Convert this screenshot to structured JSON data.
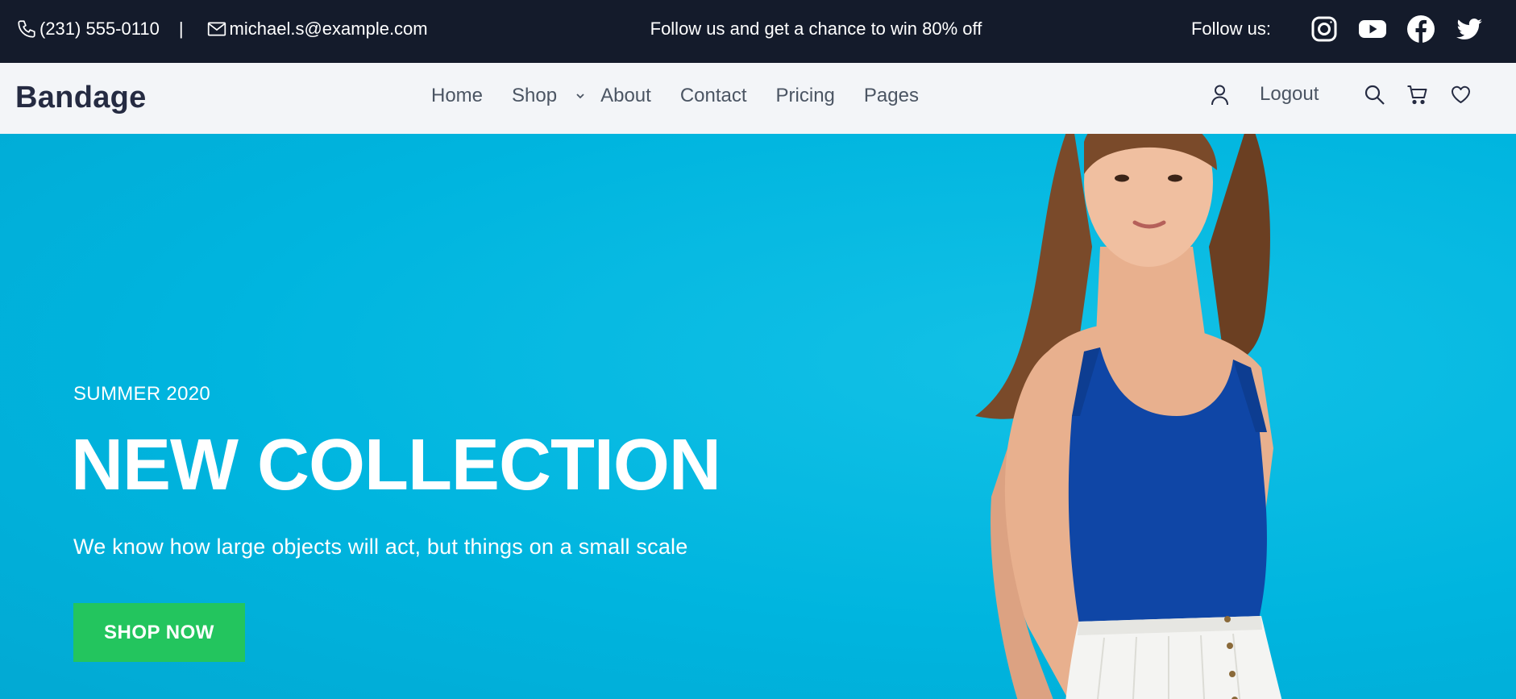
{
  "topbar": {
    "phone": "(231) 555-0110",
    "separator": "|",
    "email": "michael.s@example.com",
    "promo": "Follow us and get a chance to win 80% off",
    "follow_label": "Follow us:",
    "social_icons": [
      "instagram-icon",
      "youtube-icon",
      "facebook-icon",
      "twitter-icon"
    ]
  },
  "nav": {
    "brand": "Bandage",
    "menu": [
      "Home",
      "Shop",
      "About",
      "Contact",
      "Pricing",
      "Pages"
    ],
    "logout": "Logout",
    "icons": [
      "user-icon",
      "search-icon",
      "cart-icon",
      "heart-icon"
    ]
  },
  "hero": {
    "season": "SUMMER 2020",
    "headline": "NEW COLLECTION",
    "tagline": "We know how large objects will act, but things on a small scale",
    "cta": "SHOP NOW"
  },
  "colors": {
    "topbar_bg": "#141b2b",
    "nav_bg": "#f3f5f8",
    "hero_bg": "#00b7e0",
    "cta_bg": "#23c55e",
    "brand_text": "#252b42"
  }
}
